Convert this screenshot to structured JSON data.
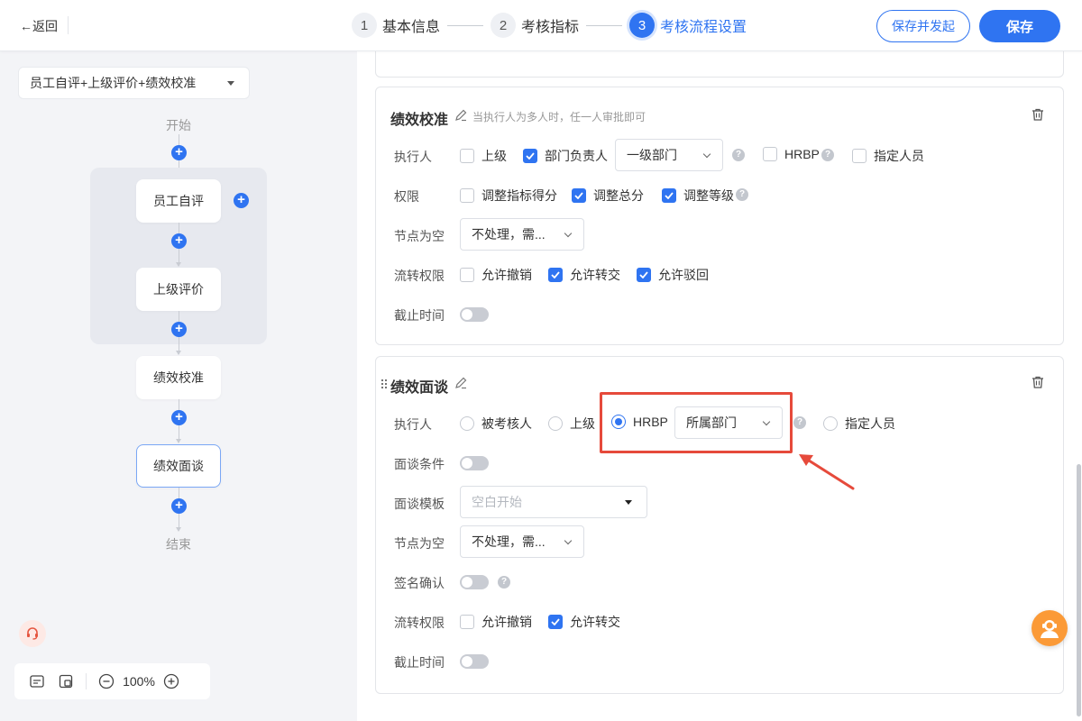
{
  "header": {
    "back_label": "←返回",
    "steps": [
      {
        "num": "1",
        "label": "基本信息"
      },
      {
        "num": "2",
        "label": "考核指标"
      },
      {
        "num": "3",
        "label": "考核流程设置"
      }
    ],
    "save_launch_label": "保存并发起",
    "save_label": "保存"
  },
  "flow": {
    "template_select": "员工自评+上级评价+绩效校准",
    "start": "开始",
    "end": "结束",
    "nodes": [
      "员工自评",
      "上级评价",
      "绩效校准",
      "绩效面谈"
    ],
    "zoom": "100%"
  },
  "calibration": {
    "title": "绩效校准",
    "hint": "当执行人为多人时，任一人审批即可",
    "executor_label": "执行人",
    "executor_options": [
      "上级",
      "部门负责人",
      "HRBP",
      "指定人员"
    ],
    "dept_select": "一级部门",
    "permission_label": "权限",
    "permission_options": [
      "调整指标得分",
      "调整总分",
      "调整等级"
    ],
    "empty_label": "节点为空",
    "empty_select": "不处理，需...",
    "transfer_label": "流转权限",
    "transfer_options": [
      "允许撤销",
      "允许转交",
      "允许驳回"
    ],
    "deadline_label": "截止时间"
  },
  "interview": {
    "title": "绩效面谈",
    "executor_label": "执行人",
    "executor_options": [
      "被考核人",
      "上级",
      "HRBP",
      "指定人员"
    ],
    "dept_select": "所属部门",
    "condition_label": "面谈条件",
    "template_label": "面谈模板",
    "template_placeholder": "空白开始",
    "empty_label": "节点为空",
    "empty_select": "不处理，需...",
    "sign_label": "签名确认",
    "transfer_label": "流转权限",
    "transfer_options": [
      "允许撤销",
      "允许转交"
    ],
    "deadline_label": "截止时间"
  },
  "colors": {
    "primary": "#2f74f1",
    "annotation": "#e64a3b",
    "assistant": "#fb9a37"
  }
}
